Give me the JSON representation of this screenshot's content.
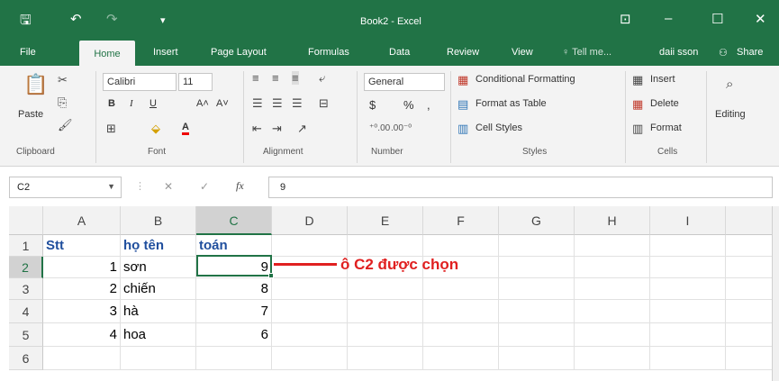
{
  "app": {
    "title": "Book2 - Excel",
    "quick_access": {
      "save": "🖫",
      "undo": "↶",
      "redo": "↷",
      "customize": "▾"
    },
    "window_controls": {
      "ribbon_display": "⊡",
      "minimize": "–",
      "maximize": "☐",
      "close": "✕"
    }
  },
  "tabs": {
    "items": [
      "File",
      "Home",
      "Insert",
      "Page Layout",
      "Formulas",
      "Data",
      "Review",
      "View"
    ],
    "active": "Home",
    "tell_me": "♀ Tell me...",
    "user": "daii sson",
    "share": "Share"
  },
  "ribbon": {
    "clipboard": {
      "paste": "Paste",
      "group": "Clipboard"
    },
    "font": {
      "name": "Calibri",
      "size": "11",
      "bold": "B",
      "italic": "I",
      "underline": "U",
      "grow": "A˄",
      "shrink": "A˅",
      "group": "Font"
    },
    "alignment": {
      "group": "Alignment"
    },
    "number": {
      "format": "General",
      "currency": "$",
      "percent": "%",
      "comma": ",",
      "group": "Number"
    },
    "styles": {
      "conditional": "Conditional Formatting",
      "table": "Format as Table",
      "cell_styles": "Cell Styles",
      "group": "Styles"
    },
    "cells": {
      "insert": "Insert",
      "delete": "Delete",
      "format": "Format",
      "group": "Cells"
    },
    "editing": {
      "label": "Editing"
    }
  },
  "formula_bar": {
    "name_box": "C2",
    "cancel": "✕",
    "enter": "✓",
    "fx": "fx",
    "value": "9"
  },
  "sheet": {
    "columns": [
      "A",
      "B",
      "C",
      "D",
      "E",
      "F",
      "G",
      "H",
      "I"
    ],
    "selected_column": "C",
    "rows": [
      {
        "num": "1",
        "A": "Stt",
        "B": "họ tên",
        "C": "toán"
      },
      {
        "num": "2",
        "A": "1",
        "B": "sơn",
        "C": "9"
      },
      {
        "num": "3",
        "A": "2",
        "B": "chiến",
        "C": "8"
      },
      {
        "num": "4",
        "A": "3",
        "B": "hà",
        "C": "7"
      },
      {
        "num": "5",
        "A": "4",
        "B": "hoa",
        "C": "6"
      },
      {
        "num": "6",
        "A": "",
        "B": "",
        "C": ""
      }
    ],
    "selected_row": "2",
    "selected_cell": "C2"
  },
  "annotation": {
    "text": "ô C2 được chọn",
    "color": "#e02020"
  },
  "colors": {
    "brand": "#217346",
    "ribbon_bg": "#f3f3f3",
    "header_text": "#1f4e9d"
  }
}
